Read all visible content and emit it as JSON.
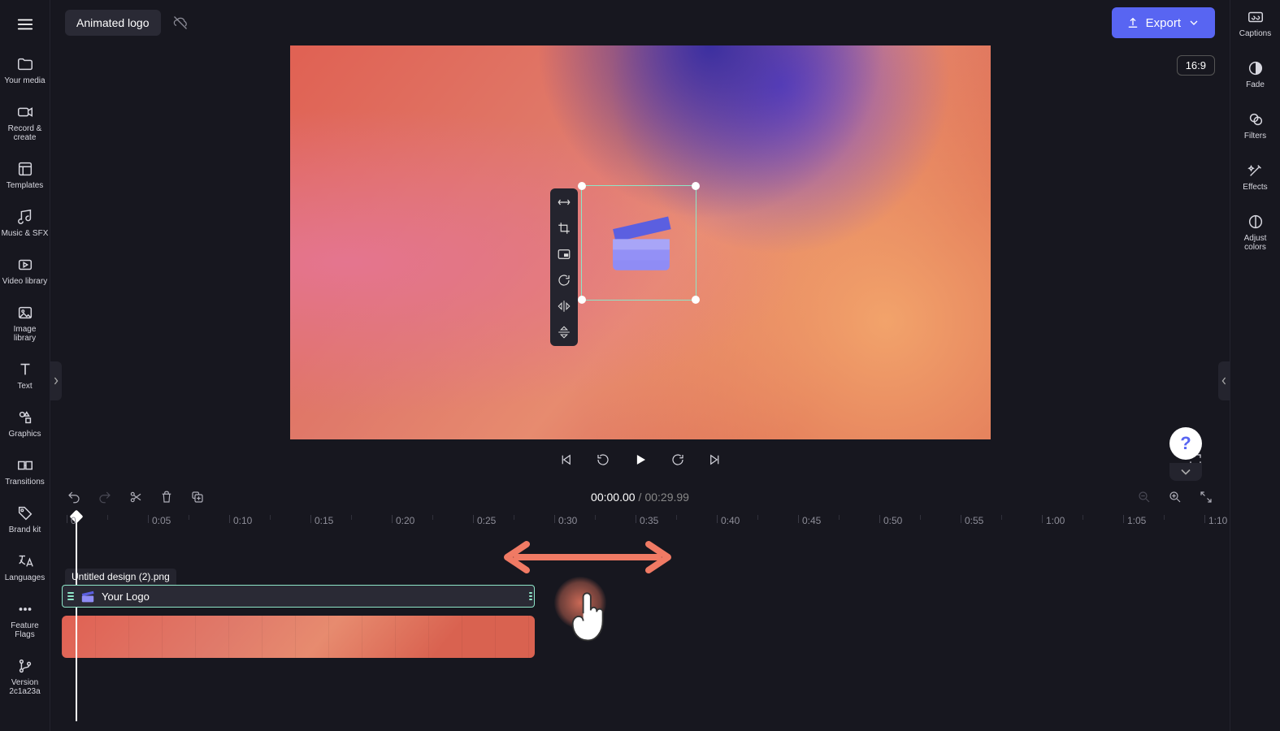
{
  "header": {
    "project_title": "Animated logo",
    "export_label": "Export",
    "aspect_ratio": "16:9"
  },
  "left_sidebar": {
    "items": [
      {
        "label": "Your media"
      },
      {
        "label": "Record &\ncreate"
      },
      {
        "label": "Templates"
      },
      {
        "label": "Music & SFX"
      },
      {
        "label": "Video library"
      },
      {
        "label": "Image\nlibrary"
      },
      {
        "label": "Text"
      },
      {
        "label": "Graphics"
      },
      {
        "label": "Transitions"
      },
      {
        "label": "Brand kit"
      },
      {
        "label": "Languages"
      },
      {
        "label": "Feature\nFlags"
      },
      {
        "label": "Version\n2c1a23a"
      }
    ]
  },
  "right_sidebar": {
    "items": [
      {
        "label": "Captions"
      },
      {
        "label": "Fade"
      },
      {
        "label": "Filters"
      },
      {
        "label": "Effects"
      },
      {
        "label": "Adjust\ncolors"
      }
    ]
  },
  "playback": {
    "timecode_current": "00:00.00",
    "timecode_total": "00:29.99"
  },
  "timeline": {
    "ruler": [
      "0",
      "0:05",
      "0:10",
      "0:15",
      "0:20",
      "0:25",
      "0:30",
      "0:35",
      "0:40",
      "0:45",
      "0:50",
      "0:55",
      "1:00",
      "1:05",
      "1:10"
    ],
    "clip_filename": "Untitled design (2).png",
    "clip_logo_label": "Your Logo"
  },
  "colors": {
    "accent": "#5865f2",
    "selection": "#8ee6c8",
    "annotation": "#f07a64"
  }
}
